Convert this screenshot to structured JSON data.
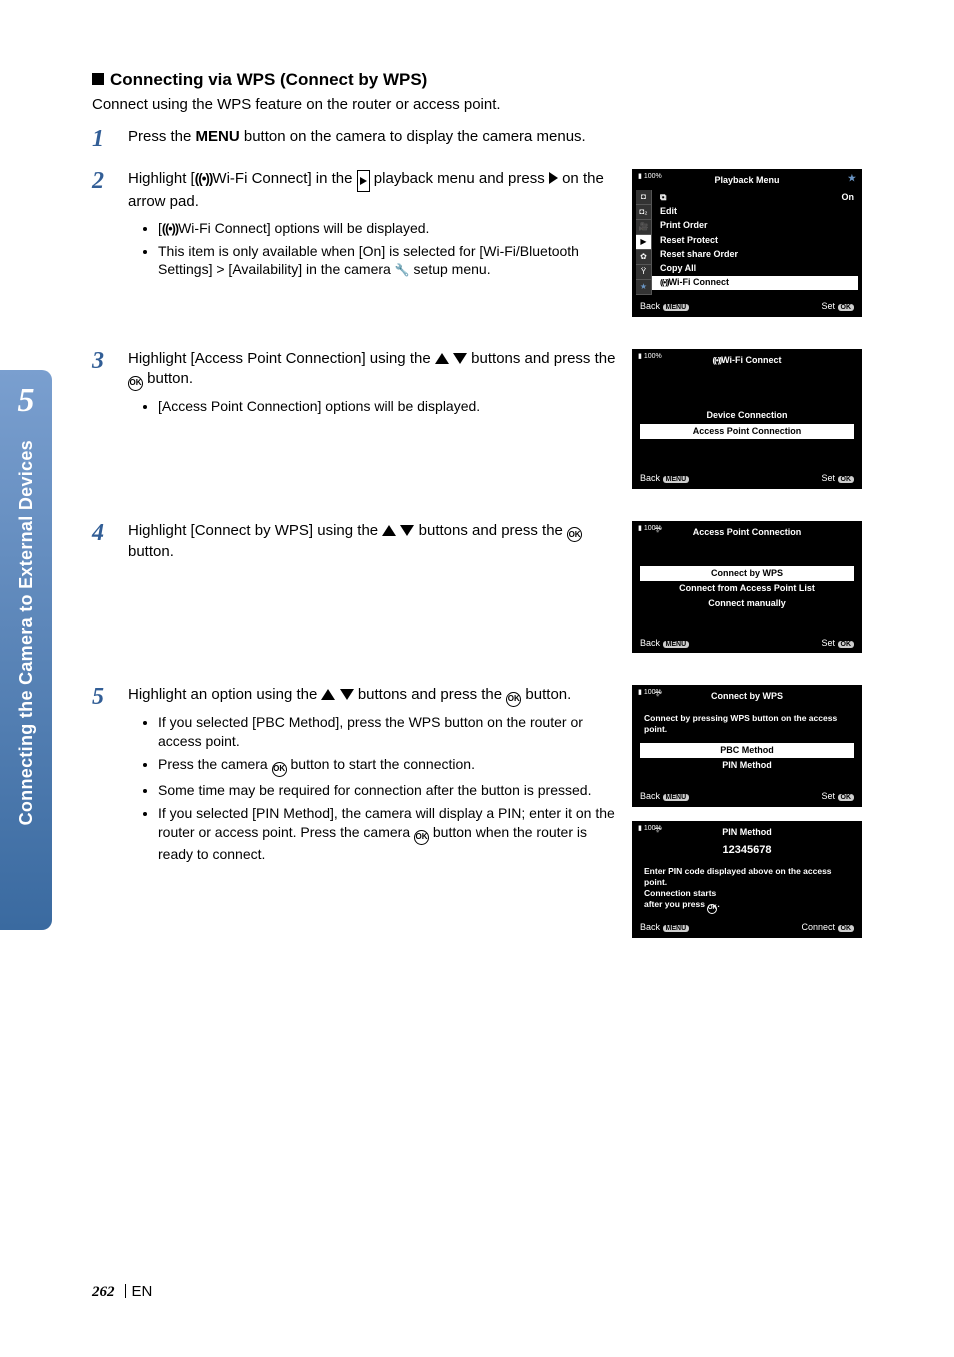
{
  "sidebar": {
    "chapter_num": "5",
    "chapter_title": "Connecting the Camera to External Devices"
  },
  "section": {
    "heading": "Connecting via WPS (Connect by WPS)",
    "intro": "Connect using the WPS feature on the router or access point."
  },
  "steps": {
    "s1": {
      "num": "1",
      "text_a": "Press the ",
      "menu_word": "MENU",
      "text_b": " button on the camera to display the camera menus."
    },
    "s2": {
      "num": "2",
      "line1_a": "Highlight [",
      "line1_b": "Wi-Fi Connect] in the ",
      "line1_c": " playback menu and press ",
      "line1_d": " on the arrow pad.",
      "bullet1_a": "[",
      "bullet1_b": "Wi-Fi Connect] options will be displayed.",
      "bullet2": "This item is only available when [On] is selected for [Wi-Fi/Bluetooth Settings] > [Availability] in the camera ",
      "bullet2_end": " setup menu."
    },
    "s3": {
      "num": "3",
      "line_a": "Highlight [Access Point Connection] using the ",
      "line_b": " buttons and press the ",
      "line_c": " button.",
      "bullet1": "[Access Point Connection] options will be displayed."
    },
    "s4": {
      "num": "4",
      "line_a": "Highlight [Connect by WPS] using the ",
      "line_b": " buttons and press the ",
      "line_c": " button."
    },
    "s5": {
      "num": "5",
      "line_a": "Highlight an option using the ",
      "line_b": " buttons and press the ",
      "line_c": " button.",
      "bullet1": "If you selected [PBC Method], press the WPS button on the router or access point.",
      "bullet2_a": "Press the camera ",
      "bullet2_b": " button to start the connection.",
      "bullet3": "Some time may be required for connection after the button is pressed.",
      "bullet4_a": "If you selected [PIN Method], the camera will display a PIN; enter it on the router or access point. Press the camera ",
      "bullet4_b": " button when the router is ready to connect."
    }
  },
  "screens": {
    "playback_menu": {
      "title": "Playback Menu",
      "on": "On",
      "items": {
        "overlay": "",
        "edit": "Edit",
        "print": "Print Order",
        "reset_protect": "Reset Protect",
        "reset_share": "Reset share Order",
        "copy_all": "Copy All",
        "wifi": "Wi-Fi Connect"
      },
      "back": "Back",
      "menu_pill": "MENU",
      "set": "Set",
      "ok_pill": "OK",
      "batt": "100%"
    },
    "wifi_connect": {
      "title": "Wi-Fi Connect",
      "device": "Device Connection",
      "ap": "Access Point Connection",
      "back": "Back",
      "menu_pill": "MENU",
      "set": "Set",
      "ok_pill": "OK",
      "batt": "100%"
    },
    "ap_conn": {
      "title": "Access Point Connection",
      "wps": "Connect by WPS",
      "list": "Connect from Access Point List",
      "manual": "Connect manually",
      "back": "Back",
      "menu_pill": "MENU",
      "set": "Set",
      "ok_pill": "OK",
      "batt": "100%"
    },
    "connect_wps": {
      "title": "Connect by WPS",
      "instr": "Connect by pressing WPS button on the access point.",
      "pbc": "PBC Method",
      "pin": "PIN Method",
      "back": "Back",
      "menu_pill": "MENU",
      "set": "Set",
      "ok_pill": "OK",
      "batt": "100%"
    },
    "pin_method": {
      "title": "PIN Method",
      "pin_code": "12345678",
      "line1": "Enter PIN code displayed above on the access point.",
      "line2": "Connection starts",
      "line3_a": "after you press ",
      "back": "Back",
      "menu_pill": "MENU",
      "connect": "Connect",
      "ok_pill": "OK",
      "batt": "100%"
    }
  },
  "footer": {
    "page": "262",
    "lang": "EN"
  }
}
